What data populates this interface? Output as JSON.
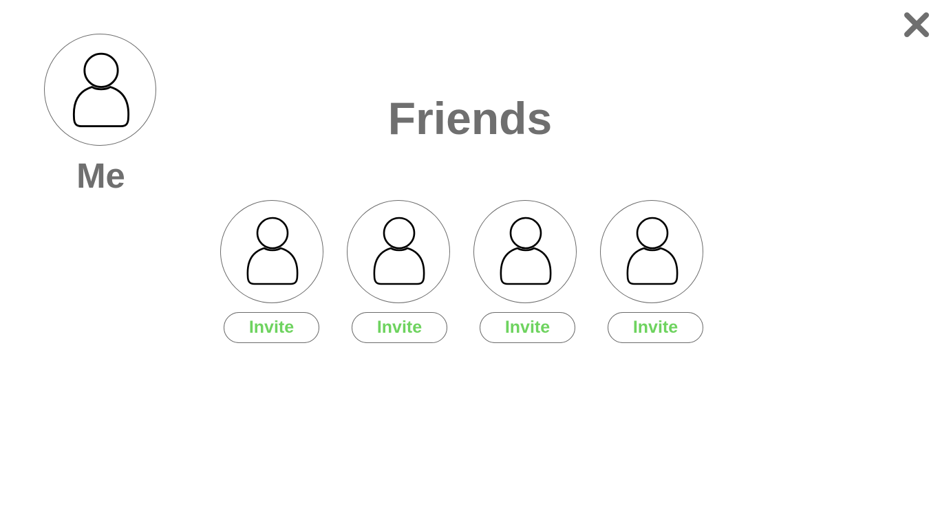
{
  "header": {
    "title": "Friends",
    "close_icon": "close-icon"
  },
  "me": {
    "label": "Me",
    "icon": "user-icon"
  },
  "friends": [
    {
      "icon": "user-icon",
      "invite_label": "Invite"
    },
    {
      "icon": "user-icon",
      "invite_label": "Invite"
    },
    {
      "icon": "user-icon",
      "invite_label": "Invite"
    },
    {
      "icon": "user-icon",
      "invite_label": "Invite"
    }
  ],
  "colors": {
    "text_gray": "#6f6f6f",
    "invite_green": "#6ed35f",
    "border_gray": "#6a6a6a",
    "close_gray": "#6f6f6f"
  }
}
